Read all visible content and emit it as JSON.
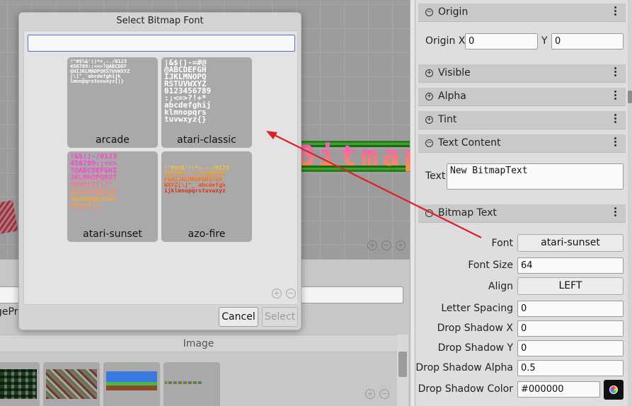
{
  "dialog": {
    "title": "Select Bitmap Font",
    "search_value": "",
    "fonts": [
      {
        "name": "arcade",
        "preview": "!\"#$%&'()*+,-./0123\n456789:;<=>?@ABCDEF\nGHIJKLMNOPQRSTUVWXYZ\n[\\]^_`abcdefghijk\nlmnopqrstuvwxyz{|}"
      },
      {
        "name": "atari-classic",
        "preview": "|&$()-=#@\n@ABCDEFGH\nIJKLMNOPQ\nRSTUVWXYZ\n0123456789\n:;<=>?!+*\nabcdefghij\nklmnopqrs\ntuvwxyz{}"
      },
      {
        "name": "atari-sunset",
        "preview": "!&$()-/0123\n456789:;<=>\n?@ABCDEFGHI\nJKLMNOPQRST\nUVWXYZ[\\]^_\nabcdefghijk\nlmnopqrstuv\nwxyz{|}~"
      },
      {
        "name": "azo-fire",
        "preview": "!\"#$%&'()*+,-./0123\n456789:;<=>?@ABCDE\nFGHIJKLMNOPQRSTUV\nWXYZ[\\]^_`abcdefgh\nijklmnopqrstuvwxyz"
      }
    ],
    "cancel_label": "Cancel",
    "select_label": "Select"
  },
  "scene": {
    "bitmap_text": "BitmapTe"
  },
  "assets": {
    "filter_value": "",
    "tab_label": "gePr",
    "section_label": "Image"
  },
  "inspector": {
    "origin": {
      "header": "Origin",
      "x_label": "Origin X",
      "x_value": "0",
      "y_label": "Y",
      "y_value": "0"
    },
    "visible_header": "Visible",
    "alpha_header": "Alpha",
    "tint_header": "Tint",
    "text_content": {
      "header": "Text Content",
      "text_label": "Text",
      "text_value": "New BitmapText"
    },
    "bitmap_text": {
      "header": "Bitmap Text",
      "font_label": "Font",
      "font_value": "atari-sunset",
      "font_size_label": "Font Size",
      "font_size_value": "64",
      "align_label": "Align",
      "align_value": "LEFT",
      "letter_spacing_label": "Letter Spacing",
      "letter_spacing_value": "0",
      "drop_shadow_x_label": "Drop Shadow X",
      "drop_shadow_x_value": "0",
      "drop_shadow_y_label": "Drop Shadow Y",
      "drop_shadow_y_value": "0",
      "drop_shadow_alpha_label": "Drop Shadow Alpha",
      "drop_shadow_alpha_value": "0.5",
      "drop_shadow_color_label": "Drop Shadow Color",
      "drop_shadow_color_value": "#000000"
    }
  },
  "colors": {
    "arrow": "#e02020",
    "search_focus": "#5a6bd0",
    "scene_text_pink": "#ff2fc8",
    "scene_bar_green": "#2a7a1e"
  }
}
